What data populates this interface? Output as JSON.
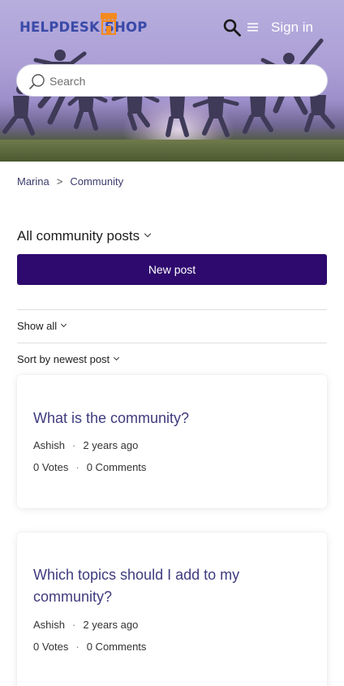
{
  "header": {
    "logo_text": "HELPDESK SHOP",
    "signin_label": "Sign in",
    "search_placeholder": "Search"
  },
  "breadcrumb": [
    {
      "label": "Marina"
    },
    {
      "label": "Community"
    }
  ],
  "breadcrumb_separator": ">",
  "filters": {
    "posts_filter_label": "All community posts",
    "new_post_label": "New post",
    "show_all_label": "Show all",
    "sort_label": "Sort by newest post"
  },
  "posts": [
    {
      "title": "What is the community?",
      "author": "Ashish",
      "time": "2 years ago",
      "votes": "0 Votes",
      "comments": "0 Comments"
    },
    {
      "title": "Which topics should I add to my community?",
      "author": "Ashish",
      "time": "2 years ago",
      "votes": "0 Votes",
      "comments": "0 Comments"
    }
  ],
  "colors": {
    "brand_primary": "#2e0a6e",
    "logo_blue": "#3a4aa8",
    "logo_orange": "#f28a1e",
    "link": "#3f3b7e"
  },
  "icons": {
    "header_search": "search-icon",
    "menu": "hamburger-menu-icon",
    "searchbox": "search-icon",
    "logo": "shop-storefront-icon"
  }
}
